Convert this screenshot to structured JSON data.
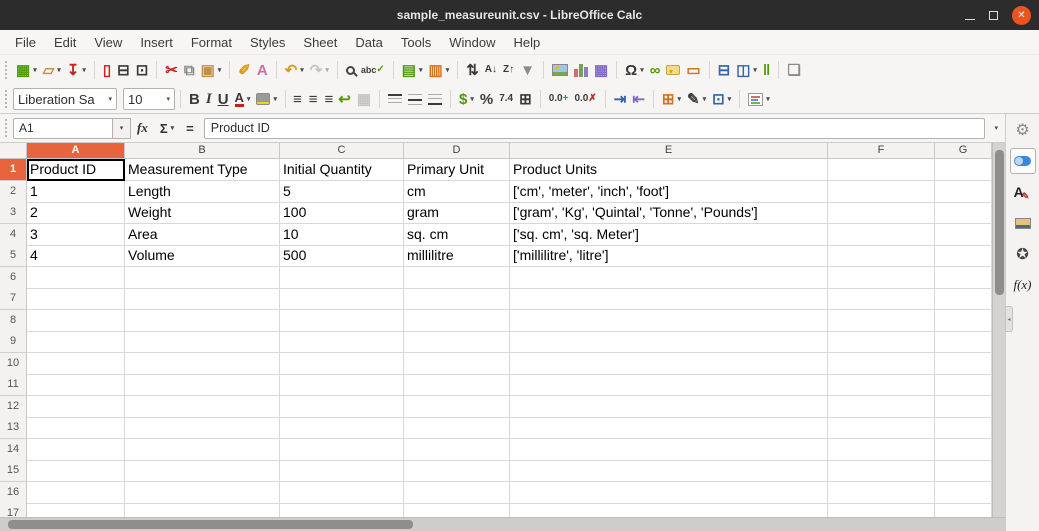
{
  "window": {
    "title": "sample_measureunit.csv - LibreOffice Calc"
  },
  "menubar": {
    "items": [
      "File",
      "Edit",
      "View",
      "Insert",
      "Format",
      "Styles",
      "Sheet",
      "Data",
      "Tools",
      "Window",
      "Help"
    ]
  },
  "standard_toolbar_icon_names": [
    "new-document-icon",
    "open-folder-icon",
    "save-icon",
    "export-pdf-icon",
    "print-icon",
    "print-preview-icon",
    "cut-icon",
    "copy-icon",
    "paste-icon",
    "clone-formatting-icon",
    "clear-formatting-icon",
    "undo-icon",
    "redo-icon",
    "find-replace-icon",
    "spelling-icon",
    "insert-rows-icon",
    "insert-columns-icon",
    "sort-icon",
    "sort-ascending-icon",
    "sort-descending-icon",
    "autofilter-icon",
    "insert-image-icon",
    "insert-chart-icon",
    "pivot-table-icon",
    "special-character-icon",
    "insert-hyperlink-icon",
    "insert-comment-icon",
    "insert-text-box-icon",
    "define-print-area-icon",
    "freeze-panes-icon",
    "split-window-icon",
    "show-draw-functions-icon"
  ],
  "formatting_toolbar": {
    "font_name": "Liberation Sa",
    "font_size": "10",
    "icon_names": [
      "bold-icon",
      "italic-icon",
      "underline-icon",
      "font-color-icon",
      "highlight-color-icon",
      "align-left-icon",
      "align-center-icon",
      "align-right-icon",
      "wrap-text-icon",
      "merge-cells-icon",
      "align-top-icon",
      "center-vertically-icon",
      "align-bottom-icon",
      "currency-icon",
      "percent-icon",
      "number-format-icon",
      "date-format-icon",
      "add-decimal-icon",
      "delete-decimal-icon",
      "increase-indent-icon",
      "decrease-indent-icon",
      "borders-icon",
      "border-style-icon",
      "border-color-icon",
      "conditional-formatting-icon"
    ]
  },
  "formula_bar": {
    "cell_reference": "A1",
    "content": "Product ID"
  },
  "icons": {
    "minimize": "–",
    "close": "✕",
    "new_document": "▦",
    "open_folder": "▱",
    "save": "↧",
    "export_pdf": "▯",
    "print": "⊟",
    "print_preview": "⊡",
    "cut": "✂",
    "copy": "⧉",
    "paste": "▣",
    "clone_formatting": "✐",
    "clear_formatting": "A",
    "undo": "↶",
    "redo": "↷",
    "spelling_abc": "abc",
    "spelling_check": "✓",
    "insert_rows": "▤",
    "insert_columns": "▥",
    "sort": "⇅",
    "sort_ascending": "A↓",
    "sort_descending": "Z↑",
    "autofilter": "▼",
    "pivot_table": "▦",
    "special_character": "Ω",
    "insert_hyperlink": "∞",
    "insert_text_box": "▭",
    "define_print_area": "⊟",
    "freeze_panes": "◫",
    "split_window": "‖",
    "show_draw_functions": "❏",
    "bold": "B",
    "italic": "I",
    "underline": "U",
    "font_color": "A",
    "align_left": "≡",
    "align_center": "≡",
    "align_right": "≡",
    "wrap_text": "↩",
    "merge_cells": "▦",
    "currency": "$",
    "percent": "%",
    "number_format": "7.4",
    "date_format": "⊞",
    "add_decimal": "0.0",
    "delete_decimal": "0.0",
    "increase_indent": "⇥",
    "decrease_indent": "⇤",
    "borders": "⊞",
    "border_style": "✎",
    "border_color": "⊡",
    "dropdown": "▾",
    "name_box_dropdown": "▾",
    "function_wizard": "fx",
    "sum": "Σ",
    "formula": "=",
    "expand_formula_bar": "▾",
    "sidebar_settings": "⚙",
    "styles_letter": "A",
    "styles_brush": "✎",
    "navigator": "✪",
    "functions": "f(x)",
    "sidebar_collapse": "◂"
  },
  "sheet": {
    "selected_cell": "A1",
    "selected_column": "A",
    "selected_row": "1",
    "column_headers": [
      "A",
      "B",
      "C",
      "D",
      "E",
      "F",
      "G"
    ],
    "rows": [
      {
        "n": "1",
        "cells": [
          "Product ID",
          "Measurement Type",
          "Initial Quantity",
          "Primary Unit",
          "Product Units",
          "",
          ""
        ]
      },
      {
        "n": "2",
        "cells": [
          "1",
          "Length",
          "5",
          "cm",
          "['cm', 'meter', 'inch', 'foot']",
          "",
          ""
        ]
      },
      {
        "n": "3",
        "cells": [
          "2",
          "Weight",
          "100",
          "gram",
          "['gram', 'Kg', 'Quintal', 'Tonne', 'Pounds']",
          "",
          ""
        ]
      },
      {
        "n": "4",
        "cells": [
          "3",
          "Area",
          "10",
          "sq. cm",
          "['sq. cm', 'sq. Meter']",
          "",
          ""
        ]
      },
      {
        "n": "5",
        "cells": [
          "4",
          "Volume",
          "500",
          "millilitre",
          "['millilitre', 'litre']",
          "",
          ""
        ]
      },
      {
        "n": "6",
        "cells": []
      },
      {
        "n": "7",
        "cells": []
      },
      {
        "n": "8",
        "cells": []
      },
      {
        "n": "9",
        "cells": []
      },
      {
        "n": "10",
        "cells": []
      },
      {
        "n": "11",
        "cells": []
      },
      {
        "n": "12",
        "cells": []
      },
      {
        "n": "13",
        "cells": []
      },
      {
        "n": "14",
        "cells": []
      },
      {
        "n": "15",
        "cells": []
      },
      {
        "n": "16",
        "cells": []
      },
      {
        "n": "17",
        "cells": []
      }
    ]
  },
  "sidebar": {
    "tab_names": [
      "sidebar-settings",
      "properties",
      "styles",
      "gallery",
      "navigator",
      "functions"
    ]
  },
  "colors": {
    "titlebar_bg": "#2c2c2c",
    "close_button": "#e95420",
    "selected_header": "#e8643c",
    "toolbar_bg": "#f6f5f4",
    "grid_line": "#d8d8d8",
    "selection_border": "#000000"
  }
}
